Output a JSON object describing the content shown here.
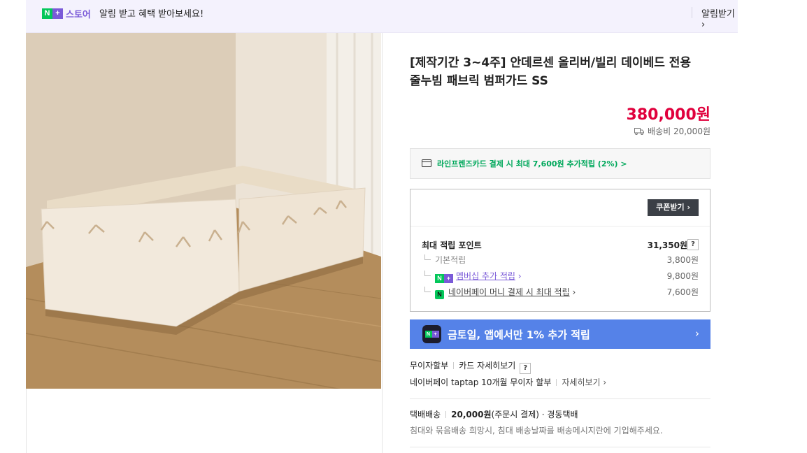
{
  "banner": {
    "logo_text": "스토어",
    "message": "알림 받고 혜택 받아보세요!",
    "alert_link": "알림받기 ›"
  },
  "product": {
    "title": "[제작기간 3~4주] 안데르센 올리버/빌리 데이베드 전용 줄누빔 패브릭 범퍼가드 SS",
    "price": "380,000원",
    "shipping_fee": "배송비 20,000원"
  },
  "card_promo": {
    "text": "라인프렌즈카드 결제 시 최대 7,600원 추가적립 (2%) >"
  },
  "points": {
    "coupon_button": "쿠폰받기 ›",
    "max_label": "최대 적립 포인트",
    "max_value": "31,350원",
    "help": "?",
    "basic_label": "기본적립",
    "basic_value": "3,800원",
    "membership_label": "멤버십 추가 적립",
    "membership_value": "9,800원",
    "npay_label": "네이버페이 머니 결제 시 최대 적립",
    "npay_value": "7,600원"
  },
  "promo_banner": {
    "text": "금토일, 앱에서만 1% 추가 적립",
    "arrow": "›"
  },
  "installment": {
    "label": "무이자할부",
    "detail_link": "카드 자세히보기",
    "help": "?",
    "taptap": "네이버페이 taptap 10개월 무이자 할부",
    "taptap_link": "자세히보기 ›"
  },
  "delivery": {
    "type": "택배배송",
    "fee": "20,000원",
    "fee_note": "(주문시 결제)",
    "carrier": "· 경동택배",
    "note": "침대와 묶음배송 희망시, 침대 배송날짜를 배송메시지란에 기입해주세요."
  },
  "colors": {
    "price_red": "#e0003c",
    "naver_green": "#03c75a",
    "plus_purple": "#7a5ad8",
    "promo_blue": "#5582e8"
  }
}
